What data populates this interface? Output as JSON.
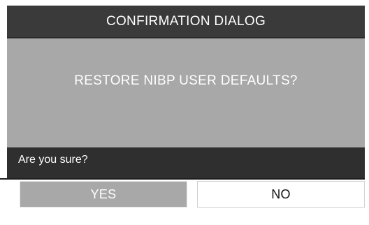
{
  "dialog": {
    "title": "CONFIRMATION DIALOG",
    "message": "RESTORE NIBP USER DEFAULTS?",
    "prompt": "Are you sure?",
    "buttons": {
      "yes_label": "YES",
      "no_label": "NO"
    }
  },
  "colors": {
    "title_bar": "#3a3a3a",
    "body": "#a8a8a8",
    "prompt_bar": "#2f2f2f",
    "yes_button": "#a8a8a8",
    "no_button": "#ffffff"
  }
}
